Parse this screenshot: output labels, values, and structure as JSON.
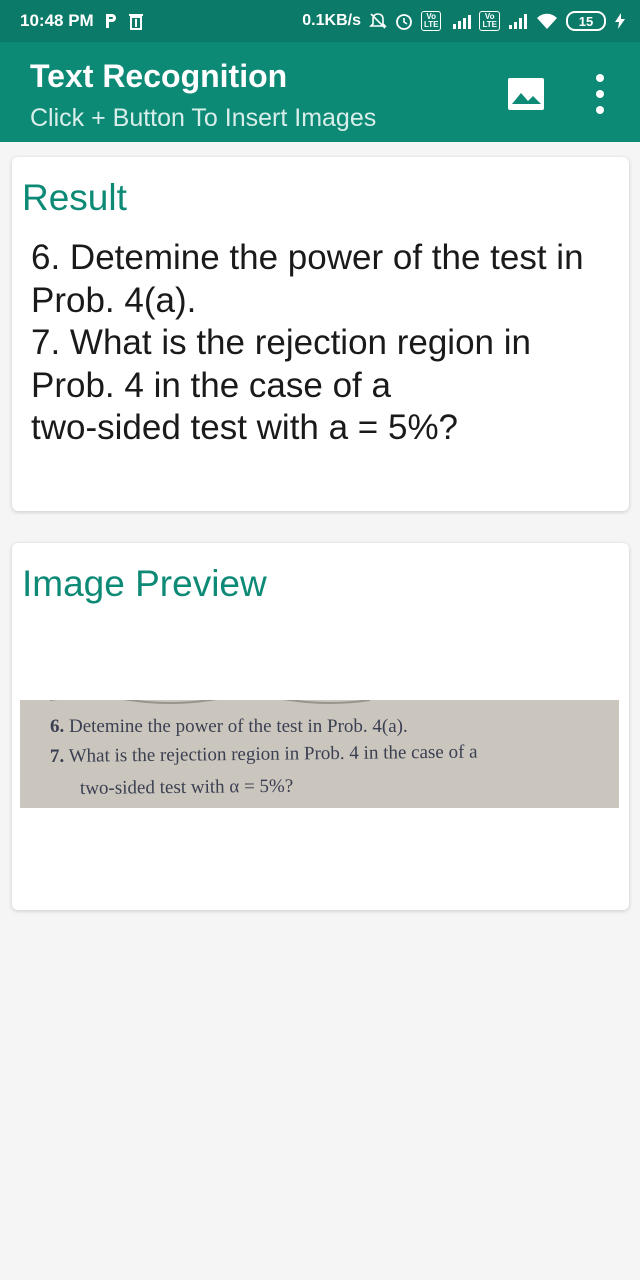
{
  "status_bar": {
    "time": "10:48 PM",
    "speed": "0.1KB/s",
    "battery": "15",
    "lte": "Vo LTE",
    "network": "4G"
  },
  "app_bar": {
    "title": "Text Recognition",
    "subtitle": "Click + Button To Insert Images"
  },
  "result_card": {
    "title": "Result",
    "lines": [
      "6. Detemine the power of the test in",
      "Prob. 4(a).",
      "7. What is the rejection region in",
      "Prob. 4 in the case of a",
      "two-sided test with a = 5%?"
    ]
  },
  "preview_card": {
    "title": "Image Preview",
    "image_lines": [
      {
        "num": "6.",
        "text": "Detemine the power of the test in Prob. 4(a)."
      },
      {
        "num": "7.",
        "text": "What is the rejection region in Prob. 4 in the case of a"
      },
      {
        "num": "",
        "text": "two-sided test with α = 5%?"
      }
    ]
  },
  "colors": {
    "primary": "#0d8a76",
    "status": "#0b7a68",
    "accent_text": "#0d8a76"
  }
}
